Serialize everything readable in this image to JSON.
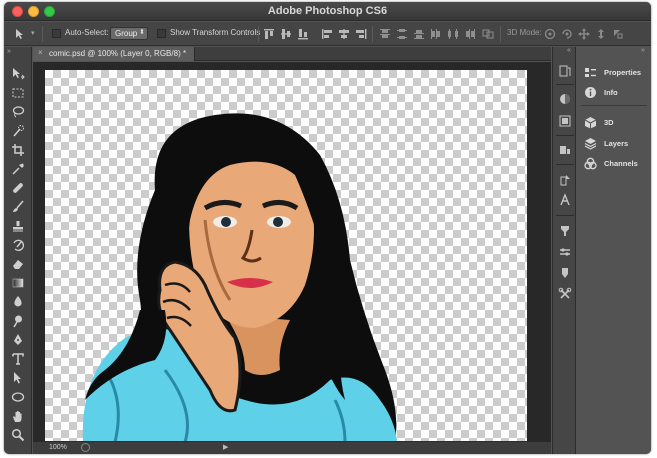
{
  "window": {
    "title": "Adobe Photoshop CS6"
  },
  "options_bar": {
    "auto_select_label": "Auto-Select:",
    "auto_select_value": "Group",
    "show_transform_label": "Show Transform Controls",
    "mode_3d_label": "3D Mode:"
  },
  "document": {
    "tab_title": "comic.psd @ 100% (Layer 0, RGB/8) *",
    "zoom": "100%"
  },
  "panels": {
    "items": [
      {
        "label": "Properties",
        "icon": "properties-icon"
      },
      {
        "label": "Info",
        "icon": "info-icon"
      },
      {
        "label": "3D",
        "icon": "3d-cube-icon"
      },
      {
        "label": "Layers",
        "icon": "layers-icon"
      },
      {
        "label": "Channels",
        "icon": "channels-icon"
      }
    ]
  },
  "colors": {
    "window_bg": "#535353",
    "titlebar": "#3c3c3c",
    "canvas_checker": "#cccccc",
    "sweater": "#5ed0e8",
    "hair": "#111111",
    "skin": "#e9a877",
    "lips": "#d83048"
  }
}
